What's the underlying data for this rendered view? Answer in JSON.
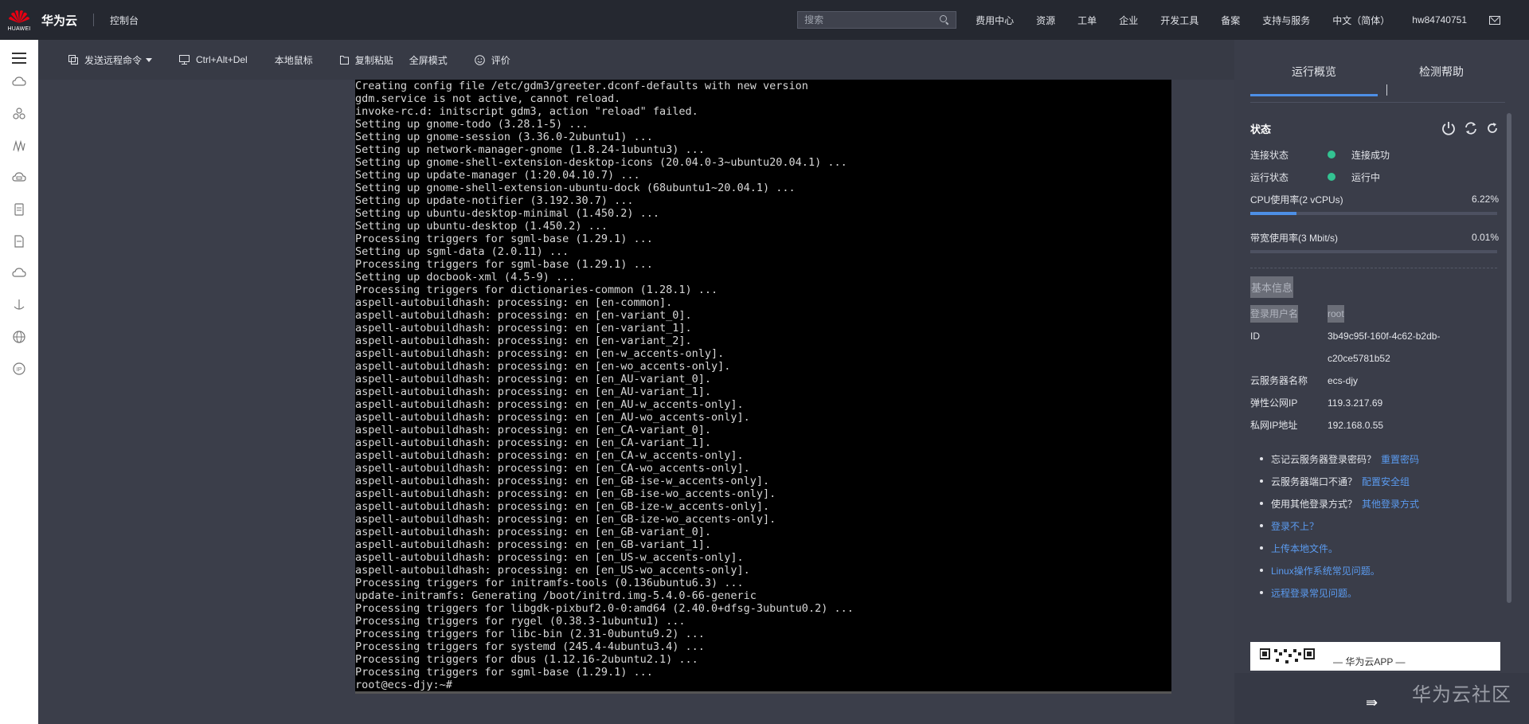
{
  "topbar": {
    "logo_text": "HUAWEI",
    "brand": "华为云",
    "console": "控制台",
    "search_placeholder": "搜索",
    "nav": [
      "费用中心",
      "资源",
      "工单",
      "企业",
      "开发工具",
      "备案",
      "支持与服务",
      "中文（简体）",
      "hw84740751"
    ]
  },
  "sidebar": {
    "icons": [
      "menu-icon",
      "cloud-icon",
      "cluster-icon",
      "chart-icon",
      "cloud-disk-icon",
      "document-icon",
      "file-icon",
      "cloud-upload-icon",
      "ship-icon",
      "globe-icon",
      "ip-icon"
    ],
    "ip_label": "IP"
  },
  "toolbar": {
    "send_command": "发送远程命令",
    "ctrl_alt_del": "Ctrl+Alt+Del",
    "local_mouse": "本地鼠标",
    "copy_paste": "复制粘贴",
    "fullscreen": "全屏模式",
    "rate": "评价"
  },
  "terminal": {
    "lines": [
      "Creating config file /etc/gdm3/greeter.dconf-defaults with new version",
      "gdm.service is not active, cannot reload.",
      "invoke-rc.d: initscript gdm3, action \"reload\" failed.",
      "Setting up gnome-todo (3.28.1-5) ...",
      "Setting up gnome-session (3.36.0-2ubuntu1) ...",
      "Setting up network-manager-gnome (1.8.24-1ubuntu3) ...",
      "Setting up gnome-shell-extension-desktop-icons (20.04.0-3~ubuntu20.04.1) ...",
      "Setting up update-manager (1:20.04.10.7) ...",
      "Setting up gnome-shell-extension-ubuntu-dock (68ubuntu1~20.04.1) ...",
      "Setting up update-notifier (3.192.30.7) ...",
      "Setting up ubuntu-desktop-minimal (1.450.2) ...",
      "Setting up ubuntu-desktop (1.450.2) ...",
      "Processing triggers for sgml-base (1.29.1) ...",
      "Setting up sgml-data (2.0.11) ...",
      "Processing triggers for sgml-base (1.29.1) ...",
      "Setting up docbook-xml (4.5-9) ...",
      "Processing triggers for dictionaries-common (1.28.1) ...",
      "aspell-autobuildhash: processing: en [en-common].",
      "aspell-autobuildhash: processing: en [en-variant_0].",
      "aspell-autobuildhash: processing: en [en-variant_1].",
      "aspell-autobuildhash: processing: en [en-variant_2].",
      "aspell-autobuildhash: processing: en [en-w_accents-only].",
      "aspell-autobuildhash: processing: en [en-wo_accents-only].",
      "aspell-autobuildhash: processing: en [en_AU-variant_0].",
      "aspell-autobuildhash: processing: en [en_AU-variant_1].",
      "aspell-autobuildhash: processing: en [en_AU-w_accents-only].",
      "aspell-autobuildhash: processing: en [en_AU-wo_accents-only].",
      "aspell-autobuildhash: processing: en [en_CA-variant_0].",
      "aspell-autobuildhash: processing: en [en_CA-variant_1].",
      "aspell-autobuildhash: processing: en [en_CA-w_accents-only].",
      "aspell-autobuildhash: processing: en [en_CA-wo_accents-only].",
      "aspell-autobuildhash: processing: en [en_GB-ise-w_accents-only].",
      "aspell-autobuildhash: processing: en [en_GB-ise-wo_accents-only].",
      "aspell-autobuildhash: processing: en [en_GB-ize-w_accents-only].",
      "aspell-autobuildhash: processing: en [en_GB-ize-wo_accents-only].",
      "aspell-autobuildhash: processing: en [en_GB-variant_0].",
      "aspell-autobuildhash: processing: en [en_GB-variant_1].",
      "aspell-autobuildhash: processing: en [en_US-w_accents-only].",
      "aspell-autobuildhash: processing: en [en_US-wo_accents-only].",
      "Processing triggers for initramfs-tools (0.136ubuntu6.3) ...",
      "update-initramfs: Generating /boot/initrd.img-5.4.0-66-generic",
      "Processing triggers for libgdk-pixbuf2.0-0:amd64 (2.40.0+dfsg-3ubuntu0.2) ...",
      "Processing triggers for rygel (0.38.3-1ubuntu1) ...",
      "Processing triggers for libc-bin (2.31-0ubuntu9.2) ...",
      "Processing triggers for systemd (245.4-4ubuntu3.4) ...",
      "Processing triggers for dbus (1.12.16-2ubuntu2.1) ...",
      "Processing triggers for sgml-base (1.29.1) ...",
      "root@ecs-djy:~#"
    ]
  },
  "panel": {
    "tab_overview": "运行概览",
    "tab_help": "检测帮助",
    "status_title": "状态",
    "conn_label": "连接状态",
    "conn_value": "连接成功",
    "run_label": "运行状态",
    "run_value": "运行中",
    "cpu_label": "CPU使用率(2 vCPUs)",
    "cpu_value": "6.22%",
    "cpu_fraction": 0.0622,
    "bw_label": "带宽使用率(3 Mbit/s)",
    "bw_value": "0.01%",
    "bw_fraction": 0.0001,
    "info_title": "基本信息",
    "login_user_label": "登录用户名",
    "login_user_value": "root",
    "id_label": "ID",
    "id_value_1": "3b49c95f-160f-4c62-b2db-",
    "id_value_2": "c20ce5781b52",
    "server_name_label": "云服务器名称",
    "server_name_value": "ecs-djy",
    "public_ip_label": "弹性公网IP",
    "public_ip_value": "119.3.217.69",
    "private_ip_label": "私网IP地址",
    "private_ip_value": "192.168.0.55",
    "tip1_text": "忘记云服务器登录密码？",
    "tip1_link": "重置密码",
    "tip2_text": "云服务器端口不通？",
    "tip2_link": "配置安全组",
    "tip3_text": "使用其他登录方式？",
    "tip3_link": "其他登录方式",
    "tip4": "登录不上？",
    "tip5": "上传本地文件。",
    "tip6": "Linux操作系统常见问题。",
    "tip7": "远程登录常见问题。",
    "qr_text": "— 华为云APP —",
    "collapse_icon": "⇛",
    "accent_color": "#4d8fe6",
    "success_color": "#33c392"
  },
  "watermark": "华为云社区"
}
